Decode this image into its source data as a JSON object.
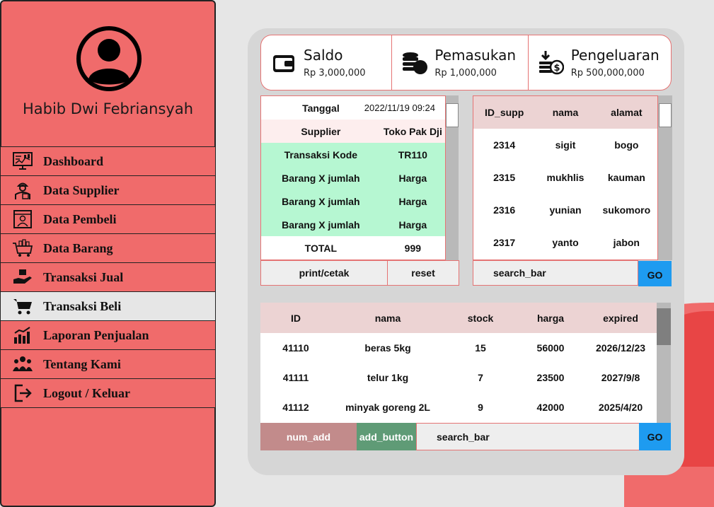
{
  "user": {
    "name": "Habib Dwi Febriansyah"
  },
  "menu": [
    {
      "label": "Dashboard",
      "icon": "dashboard-icon"
    },
    {
      "label": "Data Supplier",
      "icon": "supplier-icon"
    },
    {
      "label": "Data Pembeli",
      "icon": "buyer-icon"
    },
    {
      "label": "Data Barang",
      "icon": "goods-icon"
    },
    {
      "label": "Transaksi Jual",
      "icon": "sell-icon"
    },
    {
      "label": "Transaksi Beli",
      "icon": "cart-icon",
      "active": true
    },
    {
      "label": "Laporan Penjualan",
      "icon": "report-icon"
    },
    {
      "label": "Tentang Kami",
      "icon": "team-icon"
    },
    {
      "label": "Logout / Keluar",
      "icon": "logout-icon"
    }
  ],
  "stats": [
    {
      "title": "Saldo",
      "value": "Rp 3,000,000",
      "icon": "wallet-icon"
    },
    {
      "title": "Pemasukan",
      "value": "Rp 1,000,000",
      "icon": "coins-icon"
    },
    {
      "title": "Pengeluaran",
      "value": "Rp 500,000,000",
      "icon": "expense-icon"
    }
  ],
  "transaction": {
    "rows": [
      {
        "label": "Tanggal",
        "value": "2022/11/19 09:24"
      },
      {
        "label": "Supplier",
        "value": "Toko Pak Dji"
      },
      {
        "label": "Transaksi Kode",
        "value": "TR110"
      },
      {
        "label": "Barang X jumlah",
        "value": "Harga"
      },
      {
        "label": "Barang X jumlah",
        "value": "Harga"
      },
      {
        "label": "Barang X jumlah",
        "value": "Harga"
      },
      {
        "label": "TOTAL",
        "value": "999"
      }
    ],
    "print_label": "print/cetak",
    "reset_label": "reset"
  },
  "supplier": {
    "headers": [
      "ID_supp",
      "nama",
      "alamat"
    ],
    "rows": [
      [
        "2314",
        "sigit",
        "bogo"
      ],
      [
        "2315",
        "mukhlis",
        "kauman"
      ],
      [
        "2316",
        "yunian",
        "sukomoro"
      ],
      [
        "2317",
        "yanto",
        "jabon"
      ]
    ],
    "search_label": "search_bar",
    "go_label": "GO"
  },
  "products": {
    "headers": [
      "ID",
      "nama",
      "stock",
      "harga",
      "expired"
    ],
    "rows": [
      [
        "41110",
        "beras 5kg",
        "15",
        "56000",
        "2026/12/23"
      ],
      [
        "41111",
        "telur 1kg",
        "7",
        "23500",
        "2027/9/8"
      ],
      [
        "41112",
        "minyak goreng 2L",
        "9",
        "42000",
        "2025/4/20"
      ]
    ],
    "num_add_label": "num_add",
    "add_button_label": "add_button",
    "search_label": "search_bar",
    "go_label": "GO"
  },
  "colors": {
    "sidebar": "#f06b6b",
    "accent_border": "#e57373",
    "go_button": "#1e9bf0",
    "green_row": "#b6f7d2"
  }
}
